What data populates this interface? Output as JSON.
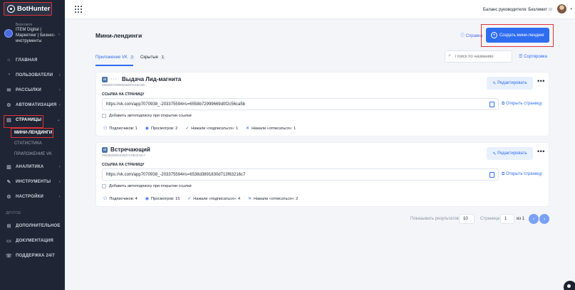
{
  "brand": {
    "name": "BotHunter"
  },
  "account": {
    "source": "Вконтакте",
    "name": "ITEM Digital | Маркетинг | Бизнес-инструменты"
  },
  "nav": {
    "items": [
      {
        "label": "Главная",
        "icon": "home-icon"
      },
      {
        "label": "Пользователи",
        "icon": "users-icon"
      },
      {
        "label": "Рассылки",
        "icon": "mail-icon"
      },
      {
        "label": "Автоматизация",
        "icon": "automation-icon"
      },
      {
        "label": "Страницы",
        "icon": "pages-icon"
      },
      {
        "label": "Аналитика",
        "icon": "analytics-icon"
      },
      {
        "label": "Инструменты",
        "icon": "tools-icon"
      },
      {
        "label": "Настройки",
        "icon": "settings-icon"
      }
    ],
    "subitems": [
      "Мини-лендинги",
      "Статистика",
      "Приложение VK"
    ],
    "section_label": "Другое",
    "extra": [
      {
        "label": "Дополнительное",
        "icon": "extra-icon"
      },
      {
        "label": "Документация",
        "icon": "docs-icon"
      },
      {
        "label": "Поддержка 24/7",
        "icon": "support-icon"
      }
    ]
  },
  "topbar": {
    "balance": "Баланс руководителя: Безлимит"
  },
  "page": {
    "title": "Мини-лендинги",
    "help": "Справка",
    "create_button": "Создать мини-лендинг",
    "tabs": [
      {
        "label": "Приложение VK",
        "count": "2"
      },
      {
        "label": "Скрытые",
        "count": "1"
      }
    ],
    "search_placeholder": "Поиск по названию",
    "sort_label": "Сортировка"
  },
  "cards": [
    {
      "title": "Выдача Лид-магнита",
      "id": "#6558b72999669d0f2c56ca5b",
      "label": "Ссылка на страницу",
      "url": "https://vk.com/app7070938_-203375594#s=6558b72999669d0f2c56ca5b",
      "open": "Открыть страницу",
      "checkbox": "Добавить автоподписку при открытии ссылки",
      "edit": "Редактировать",
      "stats": [
        "Подписчиков: 1",
        "Просмотров: 2",
        "Нажали «подписаться»: 1",
        "Нажали «отписаться»: 1"
      ]
    },
    {
      "title": "Встречающий",
      "id": "#6538d3891830d713f63216c7",
      "label": "Ссылка на страницу",
      "url": "https://vk.com/app7070938_-203375594#s=6538d3891830d713f63216c7",
      "open": "Открыть страницу",
      "checkbox": "Добавить автоподписку при открытии ссылки",
      "edit": "Редактировать",
      "stats": [
        "Подписчиков: 4",
        "Просмотров: 15",
        "Нажали «подписаться»: 4",
        "Нажали «отписаться»: 2"
      ]
    }
  ],
  "pagination": {
    "show_label": "Показывать результатов",
    "per_page": "10",
    "page_label": "Страница",
    "page": "1",
    "of_label": "из 1"
  }
}
